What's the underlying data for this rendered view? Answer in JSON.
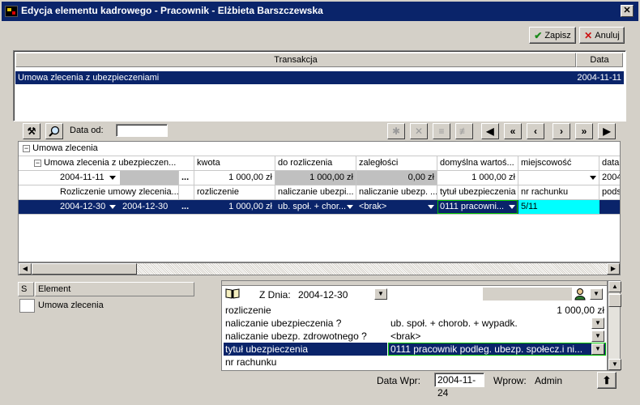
{
  "window": {
    "title": "Edycja elementu kadrowego - Pracownik - Elżbieta Barszczewska",
    "close_glyph": "✕"
  },
  "actions": {
    "save_label": "Zapisz",
    "cancel_label": "Anuluj"
  },
  "transactions": {
    "headers": [
      "Transakcja",
      "Data"
    ],
    "rows": [
      {
        "name": "Umowa zlecenia z ubezpieczeniami",
        "date": "2004-11-11"
      }
    ]
  },
  "toolbar": {
    "date_from_label": "Data od:",
    "date_from_value": ""
  },
  "tree": {
    "root": "Umowa zlecenia",
    "child": "Umowa zlecenia z ubezpieczen...",
    "grandchild": "Rozliczenie umowy zlecenia...",
    "row1_date": "2004-11-11",
    "row2_date_a": "2004-12-30",
    "row2_date_b": "2004-12-30",
    "ellipsis": "..."
  },
  "grid": {
    "header1": [
      "kwota",
      "do rozliczenia",
      "zaległości",
      "domyślna wartoś...",
      "miejscowość",
      "data"
    ],
    "row1": [
      "1 000,00 zł",
      "1 000,00 zł",
      "0,00 zł",
      "1 000,00 zł",
      "",
      "2004"
    ],
    "header2": [
      "rozliczenie",
      "naliczanie ubezpi...",
      "naliczanie ubezp. ...",
      "tytuł ubezpieczenia",
      "nr rachunku",
      "pods"
    ],
    "row2": [
      "1 000,00 zł",
      "ub. społ. + chor...",
      "<brak>",
      "0111 pracowni...",
      "5/11",
      ""
    ]
  },
  "elements": {
    "col_s": "S",
    "col_element": "Element",
    "items": [
      "Umowa zlecenia"
    ]
  },
  "detail": {
    "from_label": "Z Dnia:",
    "from_value": "2004-12-30",
    "rows": [
      {
        "label": "rozliczenie",
        "value": "1 000,00 zł"
      },
      {
        "label": "naliczanie ubezpieczenia ?",
        "value": "ub. społ. + chorob. + wypadk."
      },
      {
        "label": "naliczanie ubezp. zdrowotnego ?",
        "value": "<brak>"
      },
      {
        "label": "tytuł ubezpieczenia",
        "value": "0111 pracownik podleg. ubezp. społecz.i ni..."
      },
      {
        "label": "nr rachunku",
        "value": ""
      }
    ]
  },
  "status": {
    "entry_date_label": "Data Wpr:",
    "entry_date_value": "2004-11-24",
    "entered_by_label": "Wprow:",
    "entered_by_value": "Admin"
  },
  "colors": {
    "selection": "#0a246a",
    "cyan": "#00ffff",
    "face": "#d4d0c8"
  }
}
